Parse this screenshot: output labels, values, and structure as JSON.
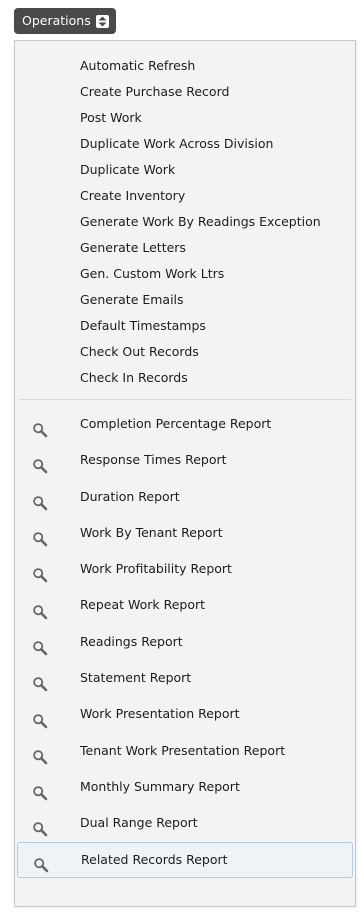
{
  "operations_button": {
    "label": "Operations",
    "icon": "updown-arrows-icon"
  },
  "actions": [
    "Automatic Refresh",
    "Create Purchase Record",
    "Post Work",
    "Duplicate Work Across Division",
    "Duplicate Work",
    "Create Inventory",
    "Generate Work By Readings Exception",
    "Generate Letters",
    "Gen. Custom Work Ltrs",
    "Generate Emails",
    "Default Timestamps",
    "Check Out Records",
    "Check In Records"
  ],
  "reports": [
    "Completion Percentage Report",
    "Response Times Report",
    "Duration Report",
    "Work By Tenant Report",
    "Work Profitability Report",
    "Repeat Work Report",
    "Readings Report",
    "Statement Report",
    "Work Presentation Report",
    "Tenant Work Presentation Report",
    "Monthly Summary Report",
    "Dual Range Report",
    "Related Records Report"
  ],
  "report_icon": "magnifier-icon",
  "highlighted_report_index": 12,
  "colors": {
    "button_bg": "#4a4a4a",
    "menu_bg": "#f3f3f3",
    "menu_border": "#c8c8c8",
    "hover_bg": "#eef3f8",
    "hover_border": "#b6cbe0",
    "icon_color": "#666666"
  }
}
